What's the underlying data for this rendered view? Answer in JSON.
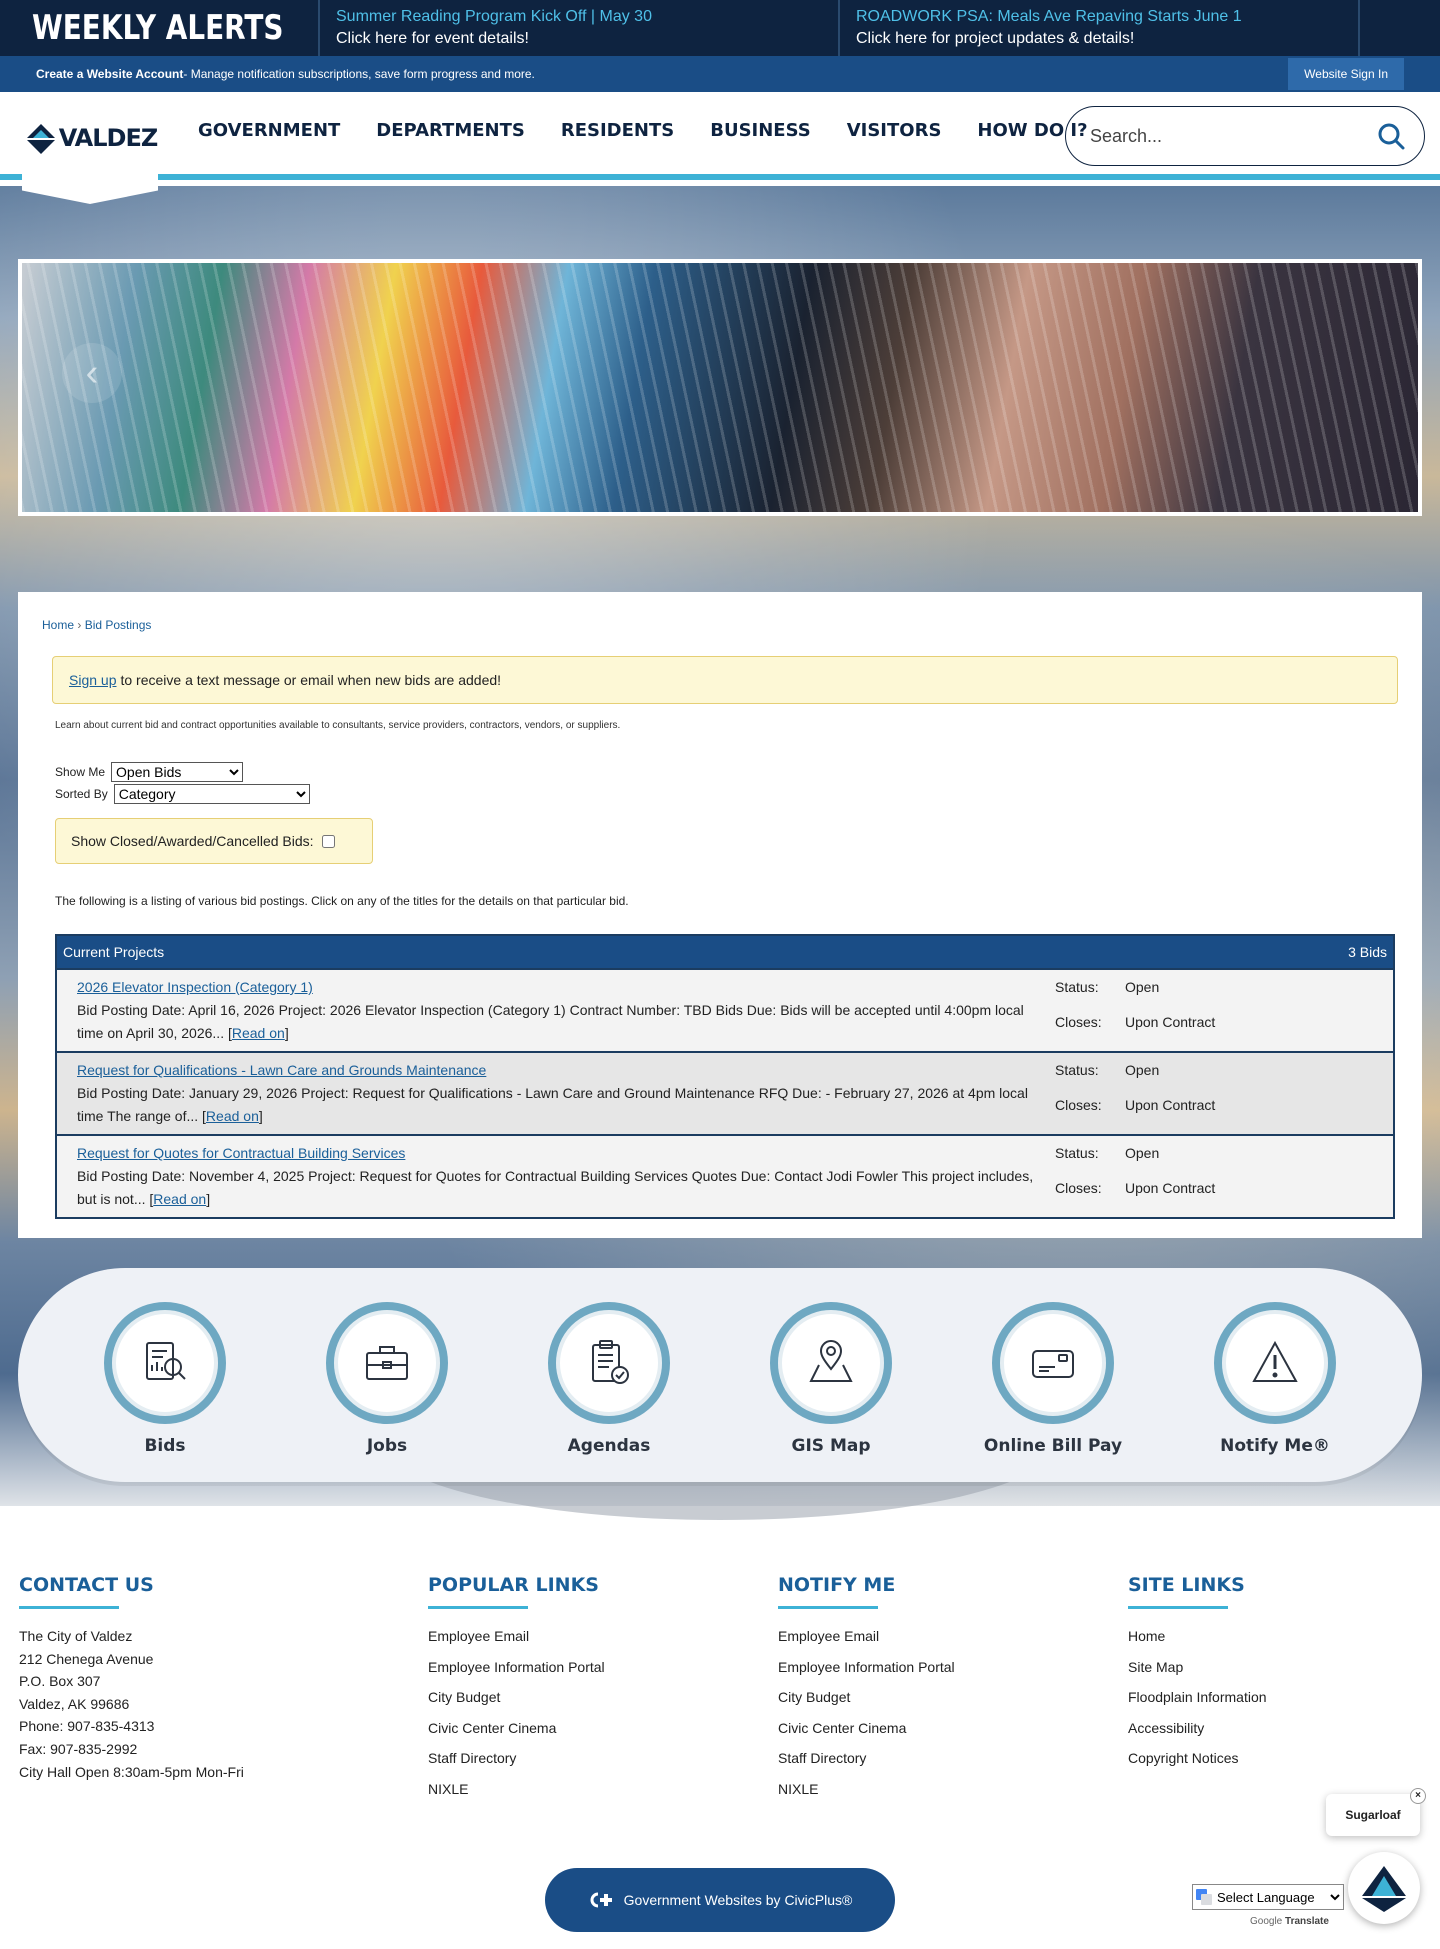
{
  "alerts": {
    "brand": "WEEKLY ALERTS",
    "items": [
      {
        "title": "Summer Reading Program Kick Off | May 30",
        "subtitle": "Click here for event details!"
      },
      {
        "title": "ROADWORK PSA: Meals Ave Repaving Starts June 1",
        "subtitle": "Click here for project updates & details!"
      }
    ]
  },
  "account": {
    "create_label": "Create a Website Account",
    "create_desc": " - Manage notification subscriptions, save form progress and more.",
    "signin_label": "Website Sign In"
  },
  "header": {
    "logo_text": "VALDEZ",
    "nav": [
      "GOVERNMENT",
      "DEPARTMENTS",
      "RESIDENTS",
      "BUSINESS",
      "VISITORS",
      "HOW DO I?"
    ],
    "search_placeholder": "Search..."
  },
  "hero": {
    "prev_icon": "‹"
  },
  "breadcrumb": {
    "home": "Home",
    "sep": "›",
    "current": "Bid Postings"
  },
  "signup": {
    "link": "Sign up",
    "text": "to receive a text message or email when new bids are added!"
  },
  "intro": "Learn about current bid and contract opportunities available to consultants, service providers, contractors, vendors, or suppliers.",
  "filters": {
    "show_me_label": "Show Me",
    "show_me_value": "Open Bids",
    "sorted_by_label": "Sorted By",
    "sorted_by_value": "Category",
    "closed_label": "Show Closed/Awarded/Cancelled Bids:"
  },
  "listing_note": "The following is a listing of various bid postings. Click on any of the titles for the details on that particular bid.",
  "bids": {
    "category": "Current Projects",
    "count": "3 Bids",
    "status_label": "Status:",
    "closes_label": "Closes:",
    "read_on": "Read on",
    "rows": [
      {
        "title": "2026 Elevator Inspection (Category 1)",
        "desc": "Bid Posting Date: April 16, 2026 Project: 2026 Elevator Inspection (Category 1) Contract Number: TBD Bids Due: Bids will be accepted until 4:00pm local time on April 30, 2026...",
        "status": "Open",
        "closes": "Upon Contract"
      },
      {
        "title": "Request for Qualifications - Lawn Care and Grounds Maintenance",
        "desc": "Bid Posting Date: January 29, 2026 Project: Request for Qualifications - Lawn Care and Ground Maintenance RFQ Due: - February 27, 2026 at 4pm local time The range of...",
        "status": "Open",
        "closes": "Upon Contract"
      },
      {
        "title": "Request for Quotes for Contractual Building Services",
        "desc": "Bid Posting Date: November 4, 2025 Project: Request for Quotes for Contractual Building Services Quotes Due: Contact Jodi Fowler This project includes, but is not...",
        "status": "Open",
        "closes": "Upon Contract"
      }
    ]
  },
  "quick_links": [
    "Bids",
    "Jobs",
    "Agendas",
    "GIS Map",
    "Online Bill Pay",
    "Notify Me®"
  ],
  "footer": {
    "contact": {
      "heading": "CONTACT US",
      "lines": [
        "The City of Valdez",
        "212 Chenega Avenue",
        "P.O. Box 307",
        "Valdez, AK 99686",
        "Phone: 907-835-4313",
        "Fax: 907-835-2992",
        "City Hall Open 8:30am-5pm Mon-Fri"
      ]
    },
    "popular": {
      "heading": "POPULAR LINKS",
      "links": [
        "Employee Email",
        "Employee Information Portal",
        "City Budget",
        "Civic Center Cinema",
        "Staff Directory",
        "NIXLE"
      ]
    },
    "notify": {
      "heading": "NOTIFY ME",
      "links": [
        "Employee Email",
        "Employee Information Portal",
        "City Budget",
        "Civic Center Cinema",
        "Staff Directory",
        "NIXLE"
      ]
    },
    "site": {
      "heading": "SITE LINKS",
      "links": [
        "Home",
        "Site Map",
        "Floodplain Information",
        "Accessibility",
        "Copyright Notices"
      ]
    },
    "civic_label": "Government Websites by CivicPlus®"
  },
  "chat": {
    "label": "Sugarloaf",
    "close": "×"
  },
  "translate": {
    "select_label": "Select Language",
    "powered_by": "Google",
    "translate_label": "Translate"
  }
}
